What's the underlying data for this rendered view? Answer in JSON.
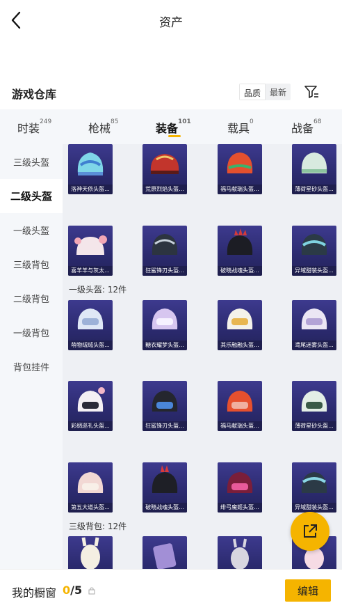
{
  "header": {
    "title": "资产"
  },
  "warehouse": {
    "title": "游戏仓库",
    "sort_options": [
      "品质",
      "最新"
    ]
  },
  "category_tabs": [
    {
      "label": "时装",
      "count": "249"
    },
    {
      "label": "枪械",
      "count": "85"
    },
    {
      "label": "装备",
      "count": "101"
    },
    {
      "label": "载具",
      "count": "0"
    },
    {
      "label": "战备",
      "count": "68"
    }
  ],
  "sidebar": {
    "items": [
      "三级头盔",
      "二级头盔",
      "一级头盔",
      "三级背包",
      "二级背包",
      "一级背包",
      "背包挂件"
    ]
  },
  "sections": {
    "one_helmet_label": "一级头盔: 12件",
    "three_backpack_label": "三级背包: 12件"
  },
  "grid": {
    "row0": [
      "洛神天依头盔...",
      "荒原烈焰头盔...",
      "福马献瑞头盔...",
      "薄荷星砂头盔..."
    ],
    "row1": [
      "喜羊羊与灰太...",
      "狂鲨锋刃头盔...",
      "破晓战魂头盔...",
      "异域甜装头盔..."
    ],
    "row2": [
      "萌物绒绒头盔...",
      "糖衣耀梦头盔...",
      "其乐融融头盔...",
      "鸢尾迷雾头盔..."
    ],
    "row3": [
      "彩绸巡礼头盔...",
      "狂鲨锋刃头盔...",
      "福马献瑞头盔...",
      "薄荷星砂头盔..."
    ],
    "row4": [
      "第五大道头盔...",
      "破晓战魂头盔...",
      "绯弓魔姬头盔...",
      "异域甜装头盔..."
    ]
  },
  "bottom_bar": {
    "showcase_label": "我的橱窗",
    "current": "0",
    "separator_total": "/5",
    "edit_label": "编辑"
  },
  "colors": {
    "accent": "#f5b400",
    "card_bg": "#2f2d78",
    "rarity": "#8c7cff"
  }
}
